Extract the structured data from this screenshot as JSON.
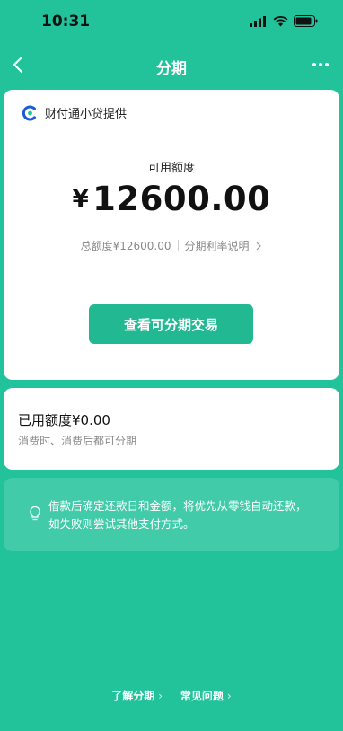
{
  "status": {
    "time": "10:31"
  },
  "nav": {
    "title": "分期"
  },
  "provider": {
    "text": "财付通小贷提供"
  },
  "quota": {
    "label": "可用额度",
    "currency": "¥",
    "amount": "12600.00",
    "total_label": "总额度¥12600.00",
    "rate_link": "分期利率说明"
  },
  "actions": {
    "view_installment": "查看可分期交易"
  },
  "used": {
    "label": "已用额度",
    "value": "¥0.00",
    "subtitle": "消费时、消费后都可分期"
  },
  "tip": {
    "text": "借款后确定还款日和金额，将优先从零钱自动还款，如失败则尝试其他支付方式。"
  },
  "footer": {
    "links": [
      "了解分期",
      "常见问题"
    ]
  },
  "colors": {
    "background": "#22c39b",
    "primary_button": "#22b992",
    "provider_logo": "#1e5ad7"
  }
}
